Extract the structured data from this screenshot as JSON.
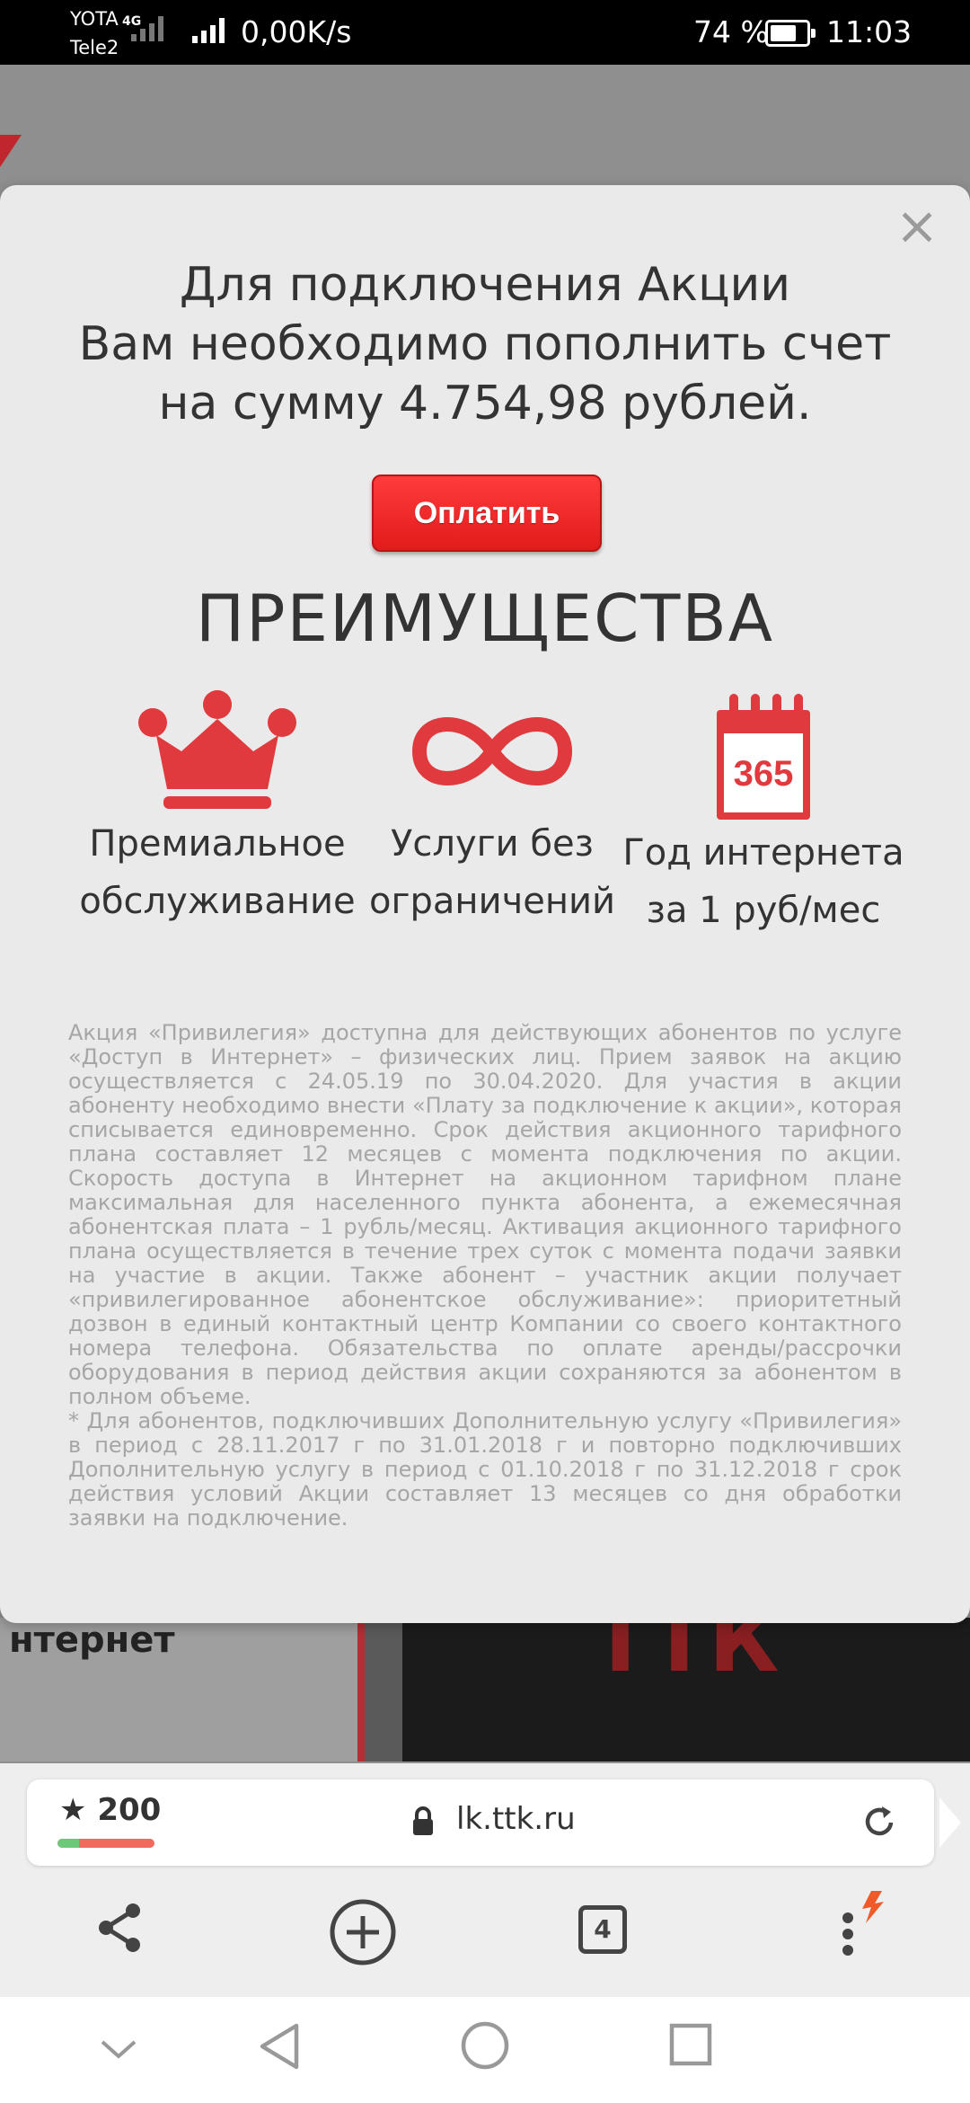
{
  "status_bar": {
    "carrier_1": "YOTA",
    "carrier_2": "Tele2",
    "network_type": "4G",
    "speed": "0,00K/s",
    "battery": "74 %",
    "battery_level": 0.74,
    "time": "11:03"
  },
  "background_page": {
    "partial_text": "нтернет",
    "logo_text": "ТТК"
  },
  "modal": {
    "headline_lines": [
      "Для подключения Акции",
      "Вам необходимо пополнить счет",
      "на сумму 4.754,98 рублей."
    ],
    "pay_button": "Оплатить",
    "close_icon": "close-icon",
    "benefits_title": "ПРЕИМУЩЕСТВА",
    "features": [
      {
        "icon": "crown-icon",
        "line1": "Премиальное",
        "line2": "обслуживание"
      },
      {
        "icon": "infinity-icon",
        "line1": "Услуги без",
        "line2": "ограничений"
      },
      {
        "icon": "calendar-365-icon",
        "line1": "Год интернета",
        "line2": "за 1 руб/мес",
        "icon_text": "365"
      }
    ],
    "accent_color": "#e0393e",
    "fine_print_1": "Акция «Привилегия» доступна для действующих абонентов по услуге «Доступ в Интернет» – физических лиц. Прием заявок на акцию осуществляется с 24.05.19 по 30.04.2020. Для участия в акции абоненту необходимо внести «Плату за подключение к акции», которая списывается единовременно. Срок действия акционного тарифного плана составляет 12 месяцев с момента подключения по акции. Скорость доступа в Интернет на акционном тарифном плане максимальная для населенного пункта абонента, а ежемесячная абонентская плата – 1 рубль/месяц. Активация акционного тарифного плана осуществляется в течение трех суток с момента подачи заявки на участие в акции. Также абонент – участник акции получает «привилегированное абонентское обслуживание»: приоритетный дозвон в единый контактный центр Компании со своего контактного номера телефона. Обязательства по оплате аренды/рассрочки оборудования в период действия акции сохраняются за абонентом в полном объеме.",
    "fine_print_2": "* Для абонентов, подключивших Дополнительную услугу «Привилегия» в период с 28.11.2017 г по 31.01.2018 г и повторно подключивших Дополнительную услугу в период с 01.10.2018 г по 31.12.2018 г срок действия условий Акции составляет 13 месяцев со дня обработки заявки на подключение."
  },
  "browser": {
    "score": "200",
    "score_ratio": 0.22,
    "url": "lk.ttk.ru",
    "tab_count": "4"
  },
  "icons": {
    "share": "share-icon",
    "new_tab": "plus-circle-icon",
    "tabs": "tabs-icon",
    "menu": "more-vert-icon",
    "back": "back-triangle-icon",
    "home": "home-circle-icon",
    "recents": "recents-square-icon",
    "hide": "chevron-down-icon"
  }
}
